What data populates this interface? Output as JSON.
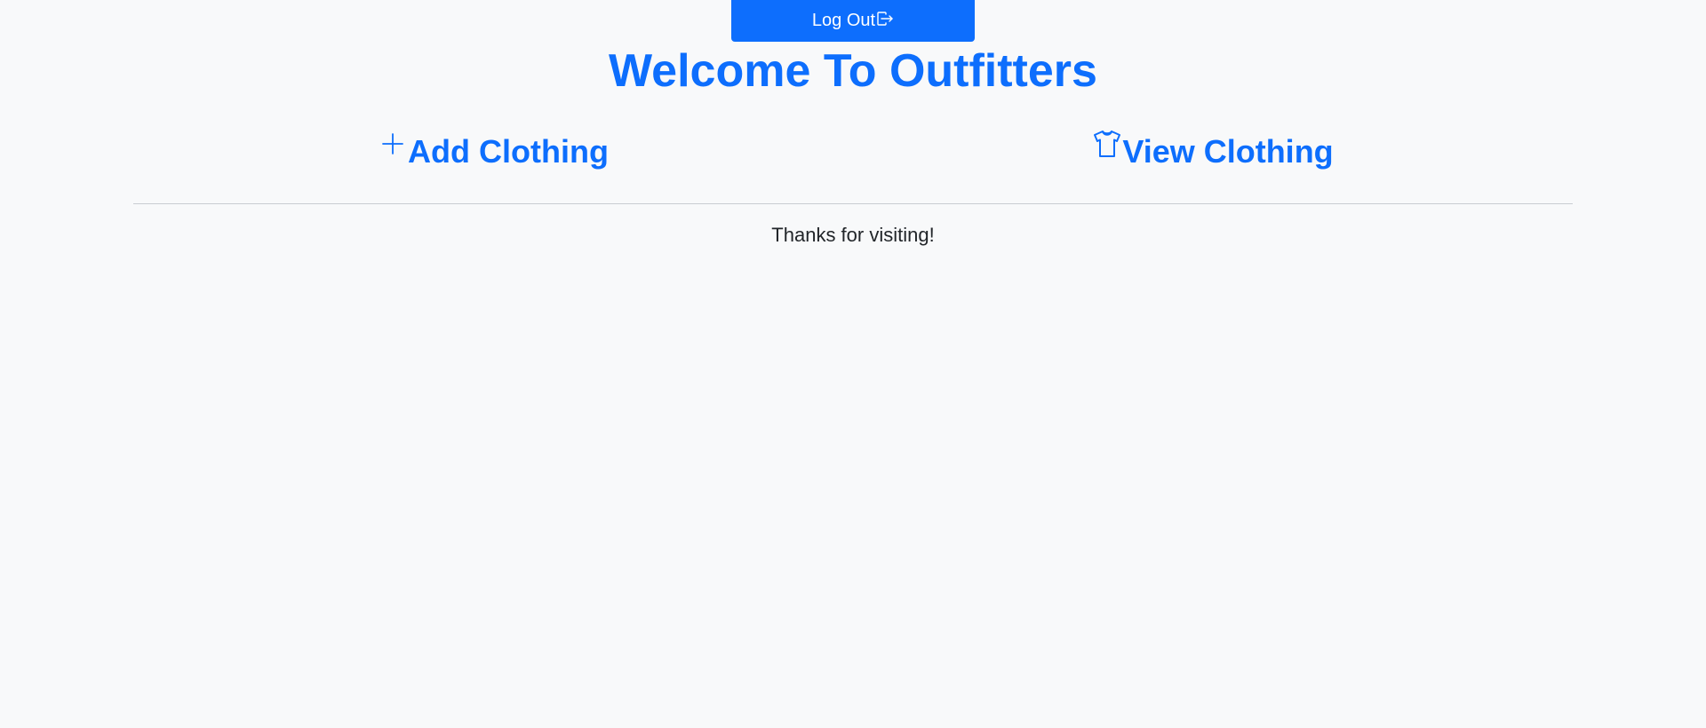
{
  "header": {
    "logout_label": "Log Out",
    "logout_icon": "box-arrow-right-icon",
    "title": "Welcome To Outfitters"
  },
  "nav": {
    "links": [
      {
        "label": "Add Clothing",
        "icon": "plus-icon"
      },
      {
        "label": "View Clothing",
        "icon": "tshirt-icon"
      }
    ]
  },
  "footer": {
    "message": "Thanks for visiting!"
  },
  "colors": {
    "accent": "#0d6efd",
    "background": "#f8f9fa",
    "text": "#212529",
    "divider": "#c9cdd1"
  }
}
